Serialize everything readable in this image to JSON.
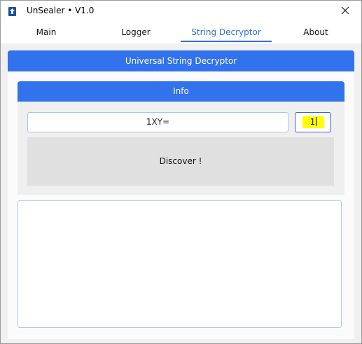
{
  "window": {
    "title": "UnSealer • V1.0"
  },
  "tabs": [
    {
      "label": "Main"
    },
    {
      "label": "Logger"
    },
    {
      "label": "String Decryptor",
      "active": true
    },
    {
      "label": "About"
    }
  ],
  "section": {
    "title": "Universal String Decryptor"
  },
  "info": {
    "title": "Info",
    "input_value": "1XY=",
    "key_value": "1",
    "discover_label": "Discover !"
  },
  "output": {
    "value": ""
  },
  "colors": {
    "accent": "#3272ec",
    "active_tab": "#2f6fe0",
    "highlight": "#ffff00"
  },
  "icons": {
    "app": "app-icon",
    "close": "close-icon"
  }
}
